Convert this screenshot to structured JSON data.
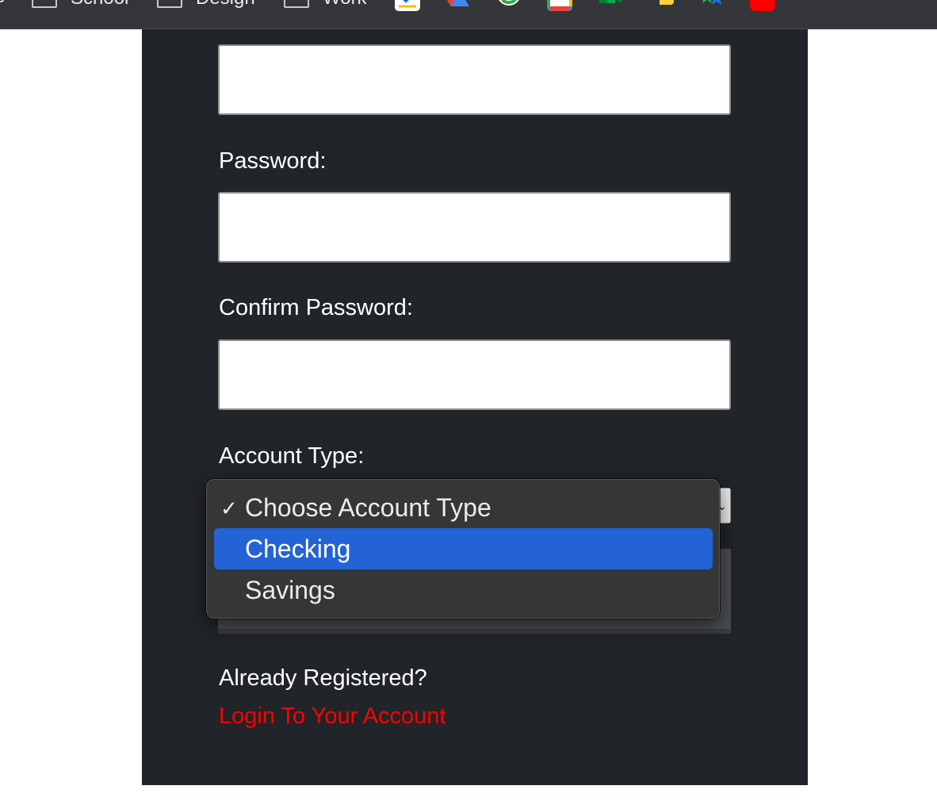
{
  "bookmarks_bar": {
    "edge_text": "s",
    "folders": [
      {
        "label": "School"
      },
      {
        "label": "Design"
      },
      {
        "label": "Work"
      }
    ],
    "icons": [
      "google-tasks-icon",
      "google-drive-icon",
      "google-icon",
      "google-calendar-icon",
      "google-meet-icon",
      "python-icon",
      "stars-extension-icon",
      "youtube-icon"
    ]
  },
  "form": {
    "password_label": "Password:",
    "confirm_password_label": "Confirm Password:",
    "account_type_label": "Account Type:",
    "account_type_dropdown": {
      "options": [
        {
          "label": "Choose Account Type",
          "checked": true,
          "highlighted": false
        },
        {
          "label": "Checking",
          "checked": false,
          "highlighted": true
        },
        {
          "label": "Savings",
          "checked": false,
          "highlighted": false
        }
      ],
      "check_glyph": "✓"
    },
    "already_registered_text": "Already Registered?",
    "login_link_text": "Login To Your Account"
  },
  "colors": {
    "panel_bg": "#212428",
    "login_link": "#ff0000",
    "highlight": "#2463d6"
  }
}
